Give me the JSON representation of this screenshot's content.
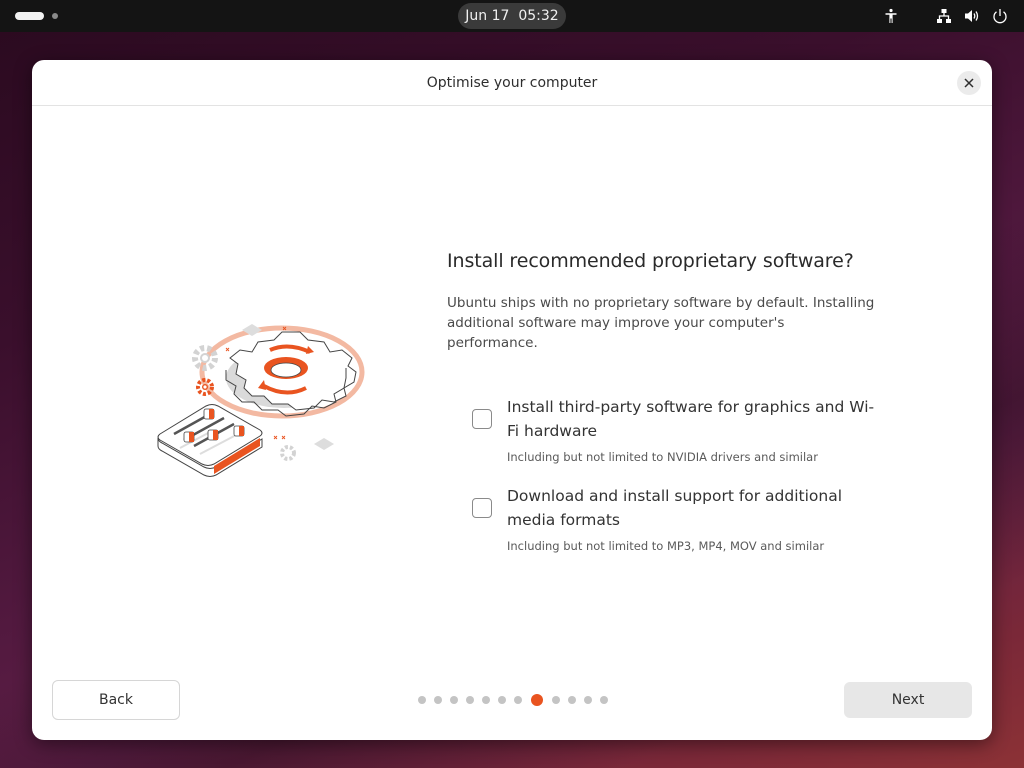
{
  "topbar": {
    "clock": "Jun 17  05:32",
    "icons": [
      "accessibility-icon",
      "network-icon",
      "volume-icon",
      "power-icon"
    ]
  },
  "dialog": {
    "title": "Optimise your computer",
    "close_icon": "close-icon",
    "heading": "Install recommended proprietary software?",
    "description": "Ubuntu ships with no proprietary software by default. Installing additional software may improve your computer's performance.",
    "options": [
      {
        "label": "Install third-party software for graphics and Wi-Fi hardware",
        "sublabel": "Including but not limited to NVIDIA drivers and similar",
        "checked": false
      },
      {
        "label": "Download and install support for additional media formats",
        "sublabel": "Including but not limited to MP3, MP4, MOV and similar",
        "checked": false
      }
    ],
    "back_label": "Back",
    "next_label": "Next",
    "pager": {
      "total": 12,
      "current": 8
    }
  },
  "colors": {
    "accent": "#e95420",
    "topbar_bg": "#141414",
    "dialog_bg": "#ffffff"
  }
}
